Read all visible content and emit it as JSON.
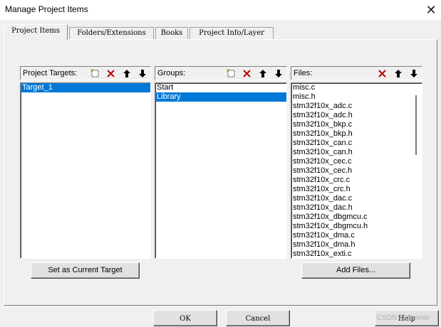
{
  "window": {
    "title": "Manage Project Items"
  },
  "tabs": [
    {
      "label": "Project Items"
    },
    {
      "label": "Folders/Extensions"
    },
    {
      "label": "Books"
    },
    {
      "label": "Project Info/Layer"
    }
  ],
  "targets": {
    "label": "Project Targets:",
    "items": [
      "Target_1"
    ],
    "selected": 0,
    "set_current_label": "Set as Current Target"
  },
  "groups": {
    "label": "Groups:",
    "items": [
      "Start",
      "Library"
    ],
    "selected": 1
  },
  "files": {
    "label": "Files:",
    "items": [
      "misc.c",
      "misc.h",
      "stm32f10x_adc.c",
      "stm32f10x_adc.h",
      "stm32f10x_bkp.c",
      "stm32f10x_bkp.h",
      "stm32f10x_can.c",
      "stm32f10x_can.h",
      "stm32f10x_cec.c",
      "stm32f10x_cec.h",
      "stm32f10x_crc.c",
      "stm32f10x_crc.h",
      "stm32f10x_dac.c",
      "stm32f10x_dac.h",
      "stm32f10x_dbgmcu.c",
      "stm32f10x_dbgmcu.h",
      "stm32f10x_dma.c",
      "stm32f10x_dma.h",
      "stm32f10x_exti.c"
    ],
    "add_files_label": "Add Files..."
  },
  "footer": {
    "ok": "OK",
    "cancel": "Cancel",
    "help": "Help"
  },
  "watermark": "CSDN @ganmin",
  "colors": {
    "selection": "#0078d7",
    "delete": "#c00000"
  }
}
